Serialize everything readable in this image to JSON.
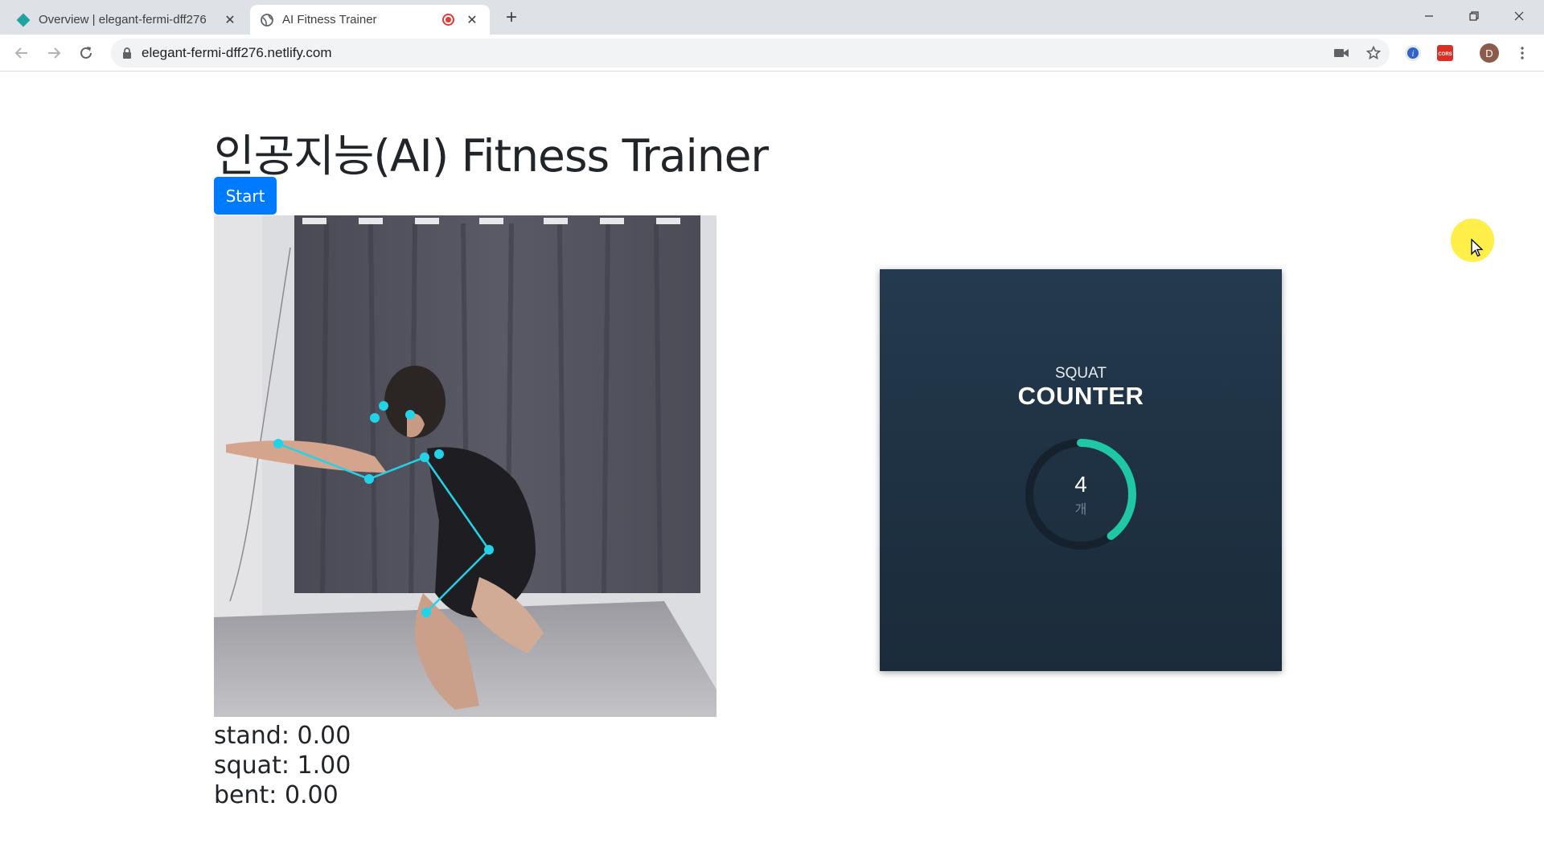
{
  "browser": {
    "tabs": [
      {
        "title": "Overview | elegant-fermi-dff276",
        "icon": "netlify-diamond-icon",
        "active": false
      },
      {
        "title": "AI Fitness Trainer",
        "icon": "globe-icon",
        "active": true,
        "recording": true
      }
    ],
    "address": "elegant-fermi-dff276.netlify.com",
    "profile_initial": "D",
    "cors_label": "CORS"
  },
  "page": {
    "heading": "인공지능(AI) Fitness Trainer",
    "start_label": "Start",
    "predictions": [
      {
        "label": "stand",
        "value": "0.00"
      },
      {
        "label": "squat",
        "value": "1.00"
      },
      {
        "label": "bent",
        "value": "0.00"
      }
    ],
    "counter": {
      "subtitle": "SQUAT",
      "title": "COUNTER",
      "count": "4",
      "unit": "개",
      "progress": 0.4,
      "accent": "#1fc7a6"
    }
  }
}
